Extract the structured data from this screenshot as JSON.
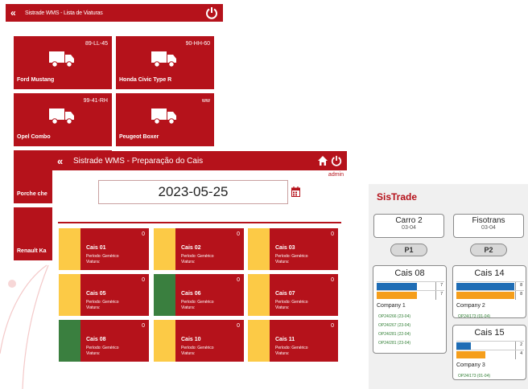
{
  "colors": {
    "brand": "#b5121b",
    "yellow": "#fcca46",
    "green": "#3a7f3f",
    "blue": "#1f6db5",
    "orange": "#f59e1b"
  },
  "vehicle_list": {
    "title": "Sistrade WMS - Lista de Viaturas",
    "back_icon": "«",
    "tiles": [
      {
        "plate": "89-LL-45",
        "name": "Ford Mustang"
      },
      {
        "plate": "90-HH-60",
        "name": "Honda Civic Type R"
      },
      {
        "plate": "99-41-RH",
        "name": "Opel Combo"
      },
      {
        "plate": "ww",
        "name": "Peugeot Boxer"
      },
      {
        "name": "Porche che"
      },
      {
        "name": "Renault Ka"
      }
    ]
  },
  "dock_prep": {
    "title": "Sistrade WMS - Preparação do Cais",
    "back_icon": "«",
    "user": "admin",
    "date": "2023-05-25",
    "docks": [
      {
        "name": "Cais 01",
        "period": "Período: Genérico",
        "vehicle": "Viatura:",
        "count": "0",
        "status": "yellow"
      },
      {
        "name": "Cais 02",
        "period": "Período: Genérico",
        "vehicle": "Viatura:",
        "count": "0",
        "status": "yellow"
      },
      {
        "name": "Cais 03",
        "period": "Período: Genérico",
        "vehicle": "Viatura:",
        "count": "0",
        "status": "yellow"
      },
      {
        "name": "Cais 05",
        "period": "Período: Genérico",
        "vehicle": "Viatura:",
        "count": "0",
        "status": "yellow"
      },
      {
        "name": "Cais 06",
        "period": "Período: Genérico",
        "vehicle": "Viatura:",
        "count": "0",
        "status": "green"
      },
      {
        "name": "Cais 07",
        "period": "Período: Genérico",
        "vehicle": "Viatura:",
        "count": "0",
        "status": "yellow"
      },
      {
        "name": "Cais 08",
        "period": "Período: Genérico",
        "vehicle": "Viatura:",
        "count": "0",
        "status": "green"
      },
      {
        "name": "Cais 10",
        "period": "Período: Genérico",
        "vehicle": "Viatura:",
        "count": "0",
        "status": "yellow"
      },
      {
        "name": "Cais 11",
        "period": "Período: Genérico",
        "vehicle": "Viatura:",
        "count": "0",
        "status": "yellow"
      }
    ]
  },
  "sistrade": {
    "brand": "SisTrade",
    "vehicles": [
      {
        "title": "Carro 2",
        "date": "03-04",
        "button": "P1"
      },
      {
        "title": "Fisotrans",
        "date": "03-04",
        "button": "P2"
      }
    ],
    "docks": [
      {
        "title": "Cais 08",
        "bars": [
          {
            "value": "7",
            "fill": 0.7,
            "color": "blue"
          },
          {
            "value": "7",
            "fill": 0.7,
            "color": "orange"
          }
        ],
        "company": "Company 1",
        "orders": [
          "OP24/266  (23-04)",
          "OP24/267  (23-04)",
          "OP24/281  (22-04)",
          "OP24/281  (23-04)"
        ]
      },
      {
        "title": "Cais 14",
        "bars": [
          {
            "value": "8",
            "fill": 1.0,
            "color": "blue"
          },
          {
            "value": "8",
            "fill": 1.0,
            "color": "orange"
          }
        ],
        "company": "Company 2",
        "orders": [
          "OP24/173  (01-04)"
        ]
      },
      {
        "title": "Cais 15",
        "bars": [
          {
            "value": "2",
            "fill": 0.25,
            "color": "blue"
          },
          {
            "value": "4",
            "fill": 0.5,
            "color": "orange"
          }
        ],
        "company": "Company 3",
        "orders": [
          "OP24/173  (01-04)"
        ]
      }
    ]
  }
}
